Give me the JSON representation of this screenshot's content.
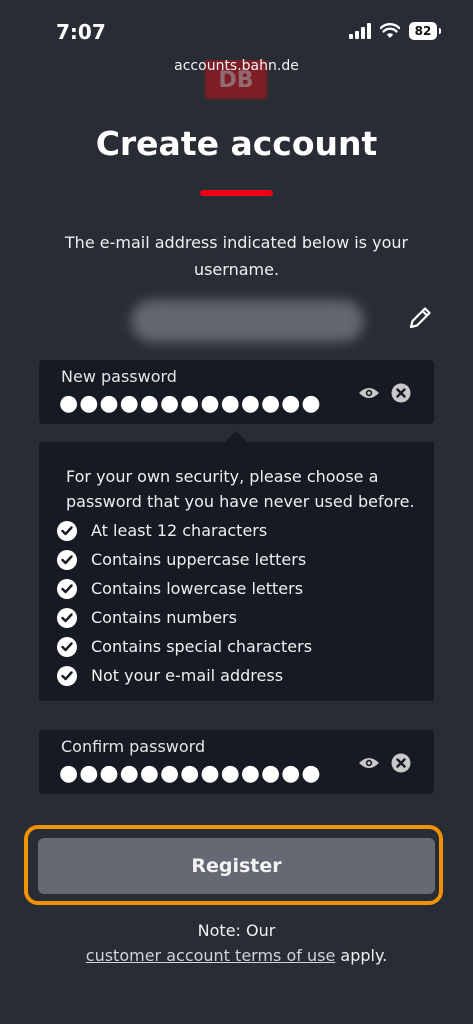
{
  "status_bar": {
    "time": "7:07",
    "battery": "82",
    "url": "accounts.bahn.de"
  },
  "logo": {
    "text": "DB",
    "icon": "db-logo"
  },
  "title": "Create account",
  "intro_text": "The e-mail address indicated below is your username.",
  "email": {
    "icon": "pencil-icon"
  },
  "new_password": {
    "label": "New password",
    "value": "●●●●●●●●●●●●●"
  },
  "requirements": {
    "intro": "For your own security, please choose a password that you have never used before.",
    "items": [
      "At least 12 characters",
      "Contains uppercase letters",
      "Contains lowercase letters",
      "Contains numbers",
      "Contains special characters",
      "Not your e-mail address"
    ]
  },
  "confirm_password": {
    "label": "Confirm password",
    "value": "●●●●●●●●●●●●●"
  },
  "register_label": "Register",
  "note": {
    "prefix": "Note: Our",
    "link": "customer account terms of use",
    "suffix": " apply."
  },
  "colors": {
    "background": "#282c35",
    "field_bg": "#161a22",
    "accent_red": "#ec0016",
    "highlight_orange": "#f39200",
    "button_bg": "#646973"
  }
}
